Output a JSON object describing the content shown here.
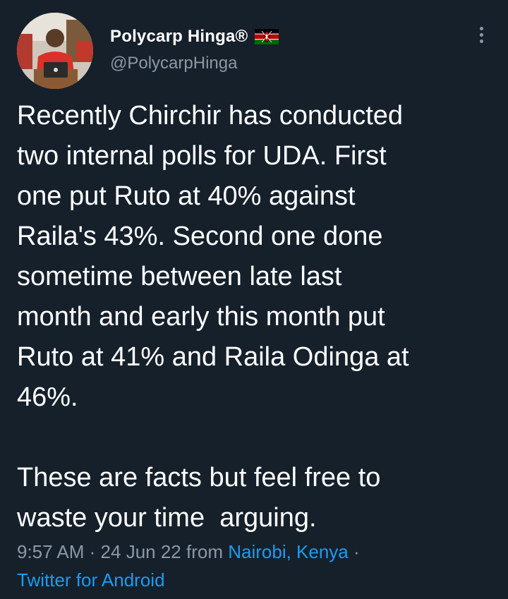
{
  "author": {
    "display_name": "Polycarp Hinga®",
    "handle": "@PolycarpHinga",
    "badge_icon": "kenya-flag-icon"
  },
  "tweet": {
    "paragraph_1_lines": [
      "Recently Chirchir has conducted",
      "two internal polls for UDA. First",
      "one put Ruto at 40% against",
      "Raila's 43%. Second one done",
      "sometime between late last",
      "month and early this month put",
      "Ruto at 41% and Raila Odinga at",
      "46%."
    ],
    "paragraph_2_lines": [
      "These are facts but feel free to",
      "waste your time  arguing."
    ]
  },
  "meta": {
    "time": "9:57 AM",
    "separator": "·",
    "date": "24 Jun 22",
    "from_word": "from",
    "location": "Nairobi, Kenya",
    "source": "Twitter for Android"
  },
  "colors": {
    "background": "#15202b",
    "text": "#ffffff",
    "muted": "#8b98a5",
    "link": "#1d9bf0"
  },
  "icons": {
    "more": "more-vertical-icon"
  }
}
